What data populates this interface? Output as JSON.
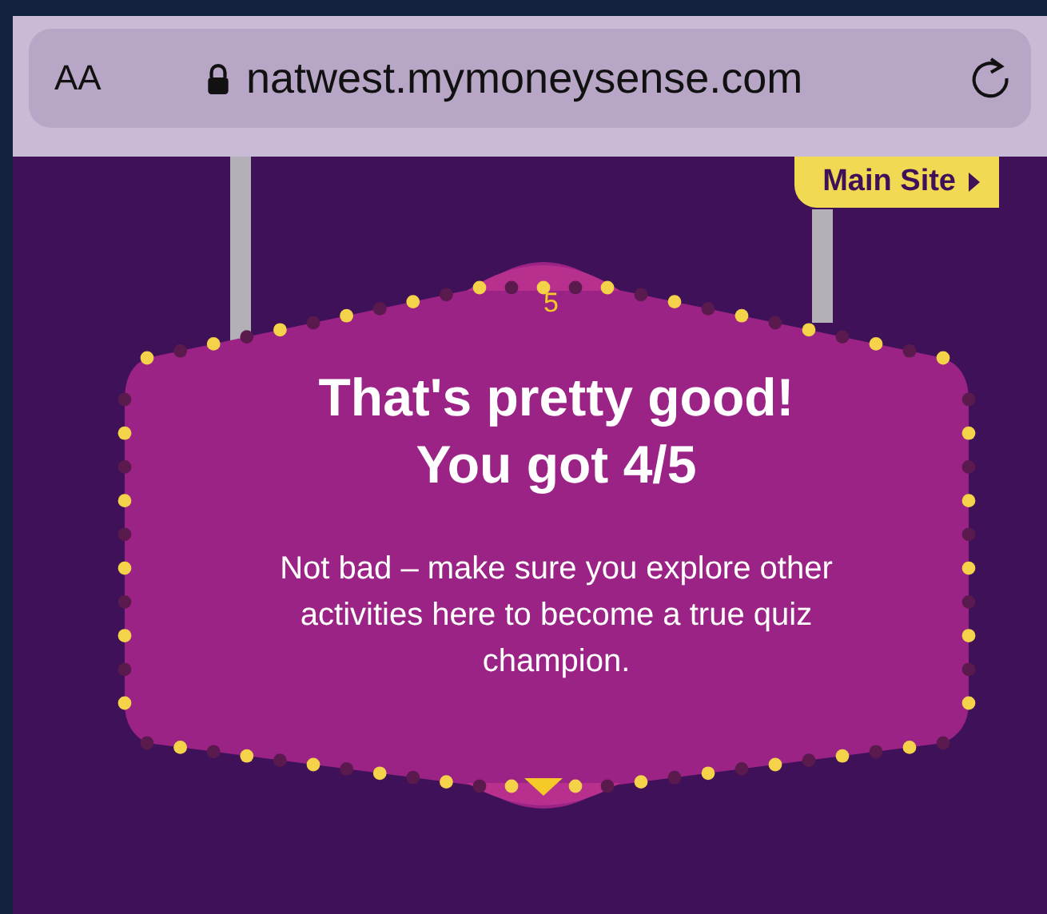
{
  "browser": {
    "text_size_button": "AA",
    "url": "natwest.mymoneysense.com"
  },
  "main_site_link": "Main Site",
  "result_sign": {
    "question_number": "5",
    "title": [
      "That's pretty good!",
      "You got 4/5"
    ],
    "message": "Not bad – make sure you explore other activities here to become a true quiz champion."
  }
}
